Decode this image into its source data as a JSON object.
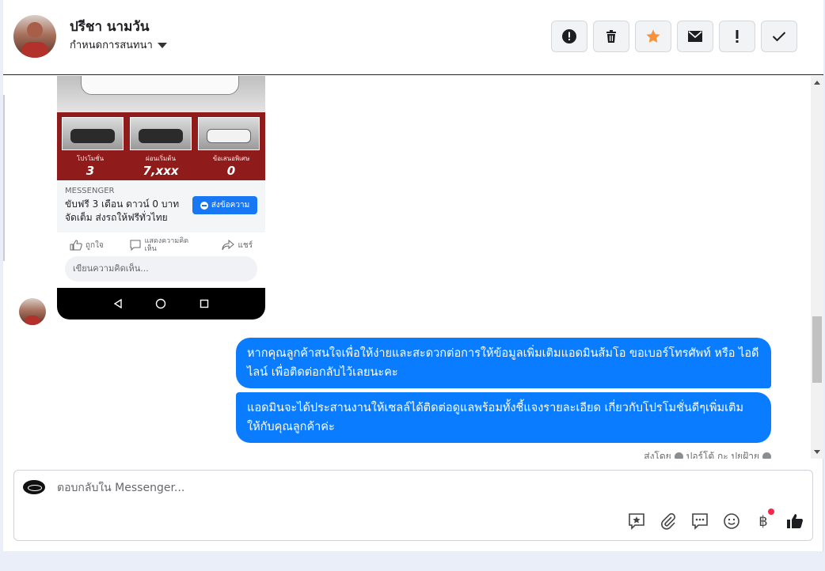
{
  "header": {
    "contact_name": "ปรีชา นามวัน",
    "assign_label": "กำหนดการสนทนา"
  },
  "ad": {
    "stat1_caption": "โปรโมชั่น",
    "stat1_value": "3",
    "stat2_caption": "ผ่อนเริ่มต้น",
    "stat2_value": "7,xxx",
    "stat3_caption": "ข้อเสนอพิเศษ",
    "stat3_value": "0",
    "messenger_label": "MESSENGER",
    "messenger_text": "ขับฟรี 3 เดือน ดาวน์ 0 บาท จัดเต็ม ส่งรถให้ฟรีทั่วไทย",
    "send_button": "ส่งข้อความ",
    "like_label": "ถูกใจ",
    "comment_label": "แสดงความคิดเห็น",
    "share_label": "แชร์",
    "comment_placeholder": "เขียนความคิดเห็น..."
  },
  "messages": [
    {
      "text": "หากคุณลูกค้าสนใจเพื่อให้ง่ายและสะดวกต่อการให้ข้อมูลเพิ่มเติมแอดมินส้มโอ ขอเบอร์โทรศัพท์ หรือ ไอดีไลน์ เพื่อติดต่อกลับไว้เลยนะคะ"
    },
    {
      "text": "แอดมินจะได้ประสานงานให้เซลล์ได้ติดต่อดูแลพร้อมทั้งชี้แจงรายละเอียด เกี่ยวกับโปรโมชั่นดีๆเพิ่มเติม ให้กับคุณลูกค้าค่ะ"
    }
  ],
  "sent_by": {
    "prefix": "ส่งโดย",
    "name": "ปอร์โต้ กะ ปยฝ้าย"
  },
  "composer": {
    "placeholder": "ตอบกลับใน Messenger..."
  },
  "colors": {
    "bubble": "#0a7cff",
    "star": "#f7923a",
    "badge": "#f02849"
  }
}
